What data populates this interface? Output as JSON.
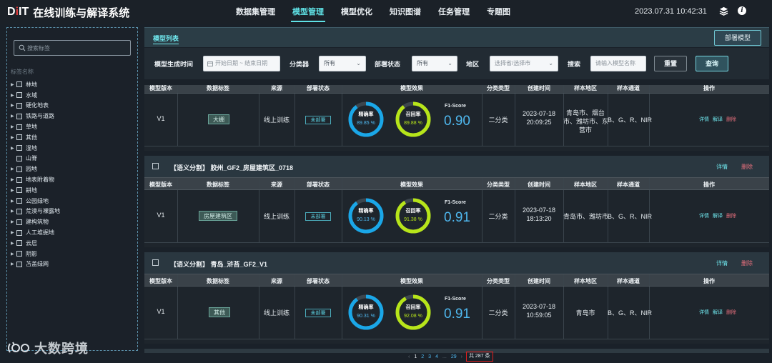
{
  "app": {
    "logo_mark": "DIIT",
    "title": "在线训练与解译系统"
  },
  "nav": [
    {
      "label": "数据集管理",
      "active": false
    },
    {
      "label": "模型管理",
      "active": true
    },
    {
      "label": "模型优化",
      "active": false
    },
    {
      "label": "知识图谱",
      "active": false
    },
    {
      "label": "任务管理",
      "active": false
    },
    {
      "label": "专题图",
      "active": false
    }
  ],
  "header": {
    "datetime": "2023.07.31 10:42:31",
    "icons": [
      "layers-icon",
      "info-icon"
    ]
  },
  "sidebar": {
    "search_placeholder": "搜索标签",
    "tags_title": "标签名称",
    "tags": [
      {
        "label": "林地",
        "expandable": true
      },
      {
        "label": "水域",
        "expandable": true
      },
      {
        "label": "硬化地表",
        "expandable": true
      },
      {
        "label": "铁路与道路",
        "expandable": true
      },
      {
        "label": "草地",
        "expandable": true
      },
      {
        "label": "其他",
        "expandable": true
      },
      {
        "label": "湿地",
        "expandable": true
      },
      {
        "label": "山脊",
        "expandable": false
      },
      {
        "label": "园地",
        "expandable": true
      },
      {
        "label": "地表附着物",
        "expandable": true
      },
      {
        "label": "耕地",
        "expandable": true
      },
      {
        "label": "公园绿地",
        "expandable": true
      },
      {
        "label": "荒漠与裸露地",
        "expandable": true
      },
      {
        "label": "建构筑物",
        "expandable": true
      },
      {
        "label": "人工堆掘地",
        "expandable": true
      },
      {
        "label": "云层",
        "expandable": true
      },
      {
        "label": "阴影",
        "expandable": true
      },
      {
        "label": "苫盖绿网",
        "expandable": true
      }
    ]
  },
  "list": {
    "title": "模型列表",
    "deploy_button": "部署模型"
  },
  "filters": {
    "gen_time_label": "模型生成时间",
    "date_range_placeholder": "开始日期 ~ 结束日期",
    "classifier_label": "分类器",
    "classifier_value": "所有",
    "deploy_status_label": "部署状态",
    "deploy_status_value": "所有",
    "region_label": "地区",
    "region_placeholder": "选择省/选择市",
    "search_label": "搜索",
    "search_placeholder": "请输入模型名称",
    "reset_button": "重置",
    "query_button": "查询"
  },
  "table_headers": [
    "模型版本",
    "数据标签",
    "来源",
    "部署状态",
    "模型效果",
    "分类类型",
    "创建时间",
    "样本地区",
    "样本通道",
    "操作"
  ],
  "cards": [
    {
      "name": "",
      "detail": "",
      "delete": "",
      "row": {
        "version": "V1",
        "tag": "大棚",
        "source": "线上训练",
        "deploy": "未部署",
        "precision_label": "精确率",
        "precision": "89.85 %",
        "precision_frac": 0.8985,
        "recall_label": "召回率",
        "recall": "89.88 %",
        "recall_frac": 0.8988,
        "f1_label": "F1-Score",
        "f1": "0.90",
        "class_type": "二分类",
        "date": "2023-07-18",
        "time": "20:09:25",
        "region_lines": [
          "青岛市、烟台",
          "市、潍坊市、东",
          "营市"
        ],
        "channels": "B、G、R、NIR",
        "op_detail": "详情",
        "op_interp": "解译",
        "op_del": "删除"
      }
    },
    {
      "name": "【语义分割】 胶州_GF2_房屋建筑区_0718",
      "detail": "详情",
      "delete": "删除",
      "row": {
        "version": "V1",
        "tag": "房屋建筑区",
        "source": "线上训练",
        "deploy": "未部署",
        "precision_label": "精确率",
        "precision": "90.13 %",
        "precision_frac": 0.9013,
        "recall_label": "召回率",
        "recall": "91.38 %",
        "recall_frac": 0.9138,
        "f1_label": "F1-Score",
        "f1": "0.91",
        "class_type": "二分类",
        "date": "2023-07-18",
        "time": "18:13:20",
        "region_lines": [
          "青岛市、潍坊市"
        ],
        "channels": "B、G、R、NIR",
        "op_detail": "详情",
        "op_interp": "解译",
        "op_del": "删除"
      }
    },
    {
      "name": "【语义分割】 青岛_浒苔_GF2_V1",
      "detail": "详情",
      "delete": "删除",
      "row": {
        "version": "V1",
        "tag": "其他",
        "source": "线上训练",
        "deploy": "未部署",
        "precision_label": "精确率",
        "precision": "90.31 %",
        "precision_frac": 0.9031,
        "recall_label": "召回率",
        "recall": "92.08 %",
        "recall_frac": 0.9208,
        "f1_label": "F1-Score",
        "f1": "0.91",
        "class_type": "二分类",
        "date": "2023-07-18",
        "time": "10:59:05",
        "region_lines": [
          "青岛市"
        ],
        "channels": "B、G、R、NIR",
        "op_detail": "详情",
        "op_interp": "解译",
        "op_del": "删除"
      }
    }
  ],
  "pagination": {
    "prev": "‹",
    "pages": [
      "1",
      "2",
      "3",
      "4",
      "...",
      "29"
    ],
    "current": "1",
    "next": "›",
    "total": "共 287 条"
  },
  "watermark": "大数跨境",
  "colors": {
    "accent": "#5fe2e6",
    "precision_ring": "#1aa7e8",
    "recall_ring": "#b7e51a",
    "delete": "#e8707d"
  }
}
